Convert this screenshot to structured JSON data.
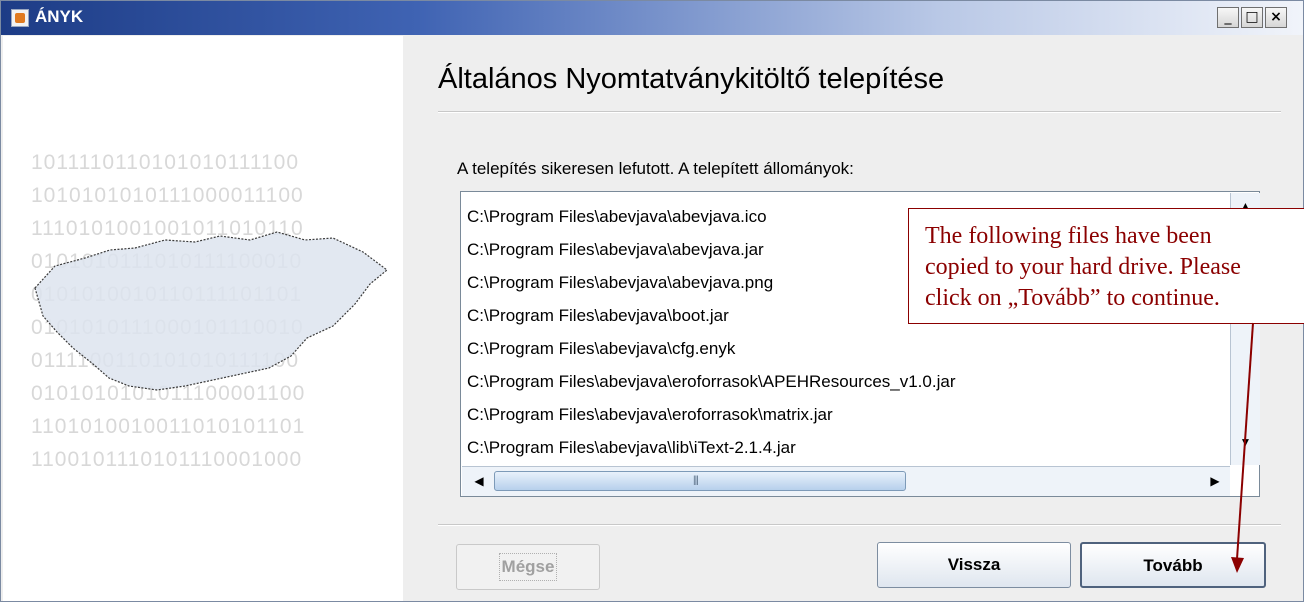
{
  "window": {
    "title": "ÁNYK",
    "controls": {
      "minimize": "_",
      "maximize": "□",
      "close": "×"
    }
  },
  "decor": {
    "binary_rows": [
      "1011110110101010111100",
      "1010101010111000011100",
      "1110101001001011010110",
      "0101010111010111100010",
      "0101010010110111101101",
      "0101010111000101110010",
      "0111100110101010111100",
      "0101010101011100001100",
      "1101010010011010101101",
      "1100101110101110001000"
    ],
    "map_icon": "hungary-map"
  },
  "main": {
    "title": "Általános Nyomtatványkitöltő telepítése",
    "status": "A telepítés sikeresen lefutott. A telepített állományok:",
    "files": [
      "C:\\Program Files\\abevjava\\abevjava.ico",
      "C:\\Program Files\\abevjava\\abevjava.jar",
      "C:\\Program Files\\abevjava\\abevjava.png",
      "C:\\Program Files\\abevjava\\boot.jar",
      "C:\\Program Files\\abevjava\\cfg.enyk",
      "C:\\Program Files\\abevjava\\eroforrasok\\APEHResources_v1.0.jar",
      "C:\\Program Files\\abevjava\\eroforrasok\\matrix.jar",
      "C:\\Program Files\\abevjava\\lib\\iText-2.1.4.jar"
    ]
  },
  "buttons": {
    "cancel": "Mégse",
    "back": "Vissza",
    "next": "Tovább"
  },
  "annotation": {
    "lines": [
      "The following files have been",
      "copied to your hard drive. Please",
      "click on „Tovább” to continue."
    ],
    "color": "#8b0000"
  },
  "colors": {
    "titlebar_start": "#1d3c86",
    "window_bg": "#eeeeee"
  }
}
